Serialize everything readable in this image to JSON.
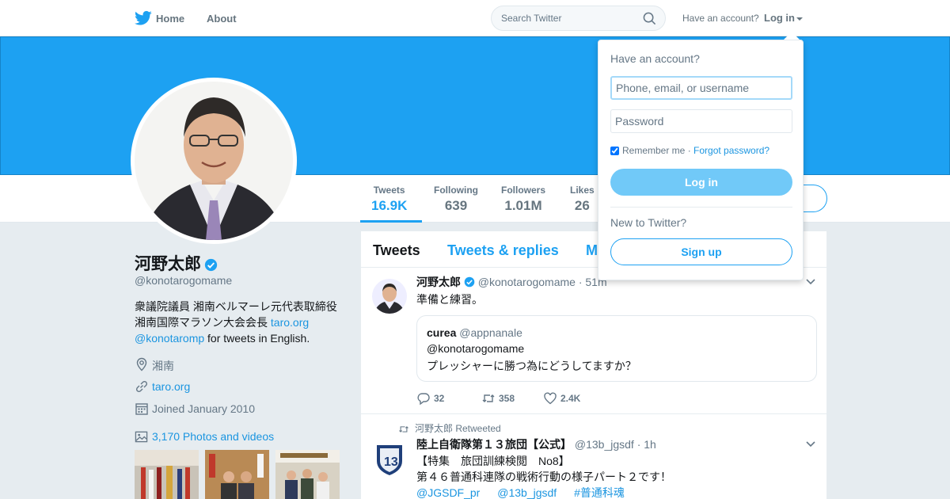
{
  "topbar": {
    "logo_icon": "twitter-bird-icon",
    "home_label": "Home",
    "about_label": "About",
    "search_placeholder": "Search Twitter",
    "have_account": "Have an account?",
    "login_label": "Log in"
  },
  "colors": {
    "brand": "#1da1f2",
    "link": "#1b95e0",
    "muted": "#657786",
    "background": "#e6ecf0"
  },
  "profile": {
    "name": "河野太郎",
    "handle": "@konotarogomame",
    "bio_text": "衆議院議員 湘南ベルマーレ元代表取締役 湘南国際マラソン大会会長 ",
    "bio_link": "taro.org",
    "bio_mention": "@konotaromp",
    "bio_suffix": " for tweets in English.",
    "location": "湘南",
    "website": "taro.org",
    "joined": "Joined January 2010",
    "photos": "3,170 Photos and videos"
  },
  "stats": [
    {
      "label": "Tweets",
      "value": "16.9K"
    },
    {
      "label": "Following",
      "value": "639"
    },
    {
      "label": "Followers",
      "value": "1.01M"
    },
    {
      "label": "Likes",
      "value": "26"
    }
  ],
  "timeline": {
    "tabs": [
      "Tweets",
      "Tweets & replies",
      "M"
    ],
    "tweet1": {
      "name": "河野太郎",
      "handle": "@konotarogomame",
      "time": "· 51m",
      "text": "準備と練習。",
      "quote_name": "curea",
      "quote_handle": "@appnanale",
      "quote_line1": "@konotarogomame",
      "quote_line2": "プレッシャーに勝つ為にどうしてますか？",
      "replies": "32",
      "retweets": "358",
      "likes": "2.4K"
    },
    "tweet2": {
      "retweeted_by": "河野太郎 Retweeted",
      "name": "陸上自衛隊第１３旅団【公式】",
      "handle": "@13b_jgsdf",
      "time": "· 1h",
      "line1": "【特集　旅団訓練検閲　No8】",
      "line2": "第４６普通科連隊の戦術行動の様子パート２です！",
      "tag1": "@JGSDF_pr",
      "tag2": "@13b_jgsdf",
      "tag3": "#普通科魂"
    }
  },
  "login_dropdown": {
    "title": "Have an account?",
    "username_placeholder": "Phone, email, or username",
    "password_placeholder": "Password",
    "remember": "Remember me",
    "separator": " · ",
    "forgot": "Forgot password?",
    "login_button": "Log in",
    "new_text": "New to Twitter?",
    "signup_button": "Sign up"
  }
}
